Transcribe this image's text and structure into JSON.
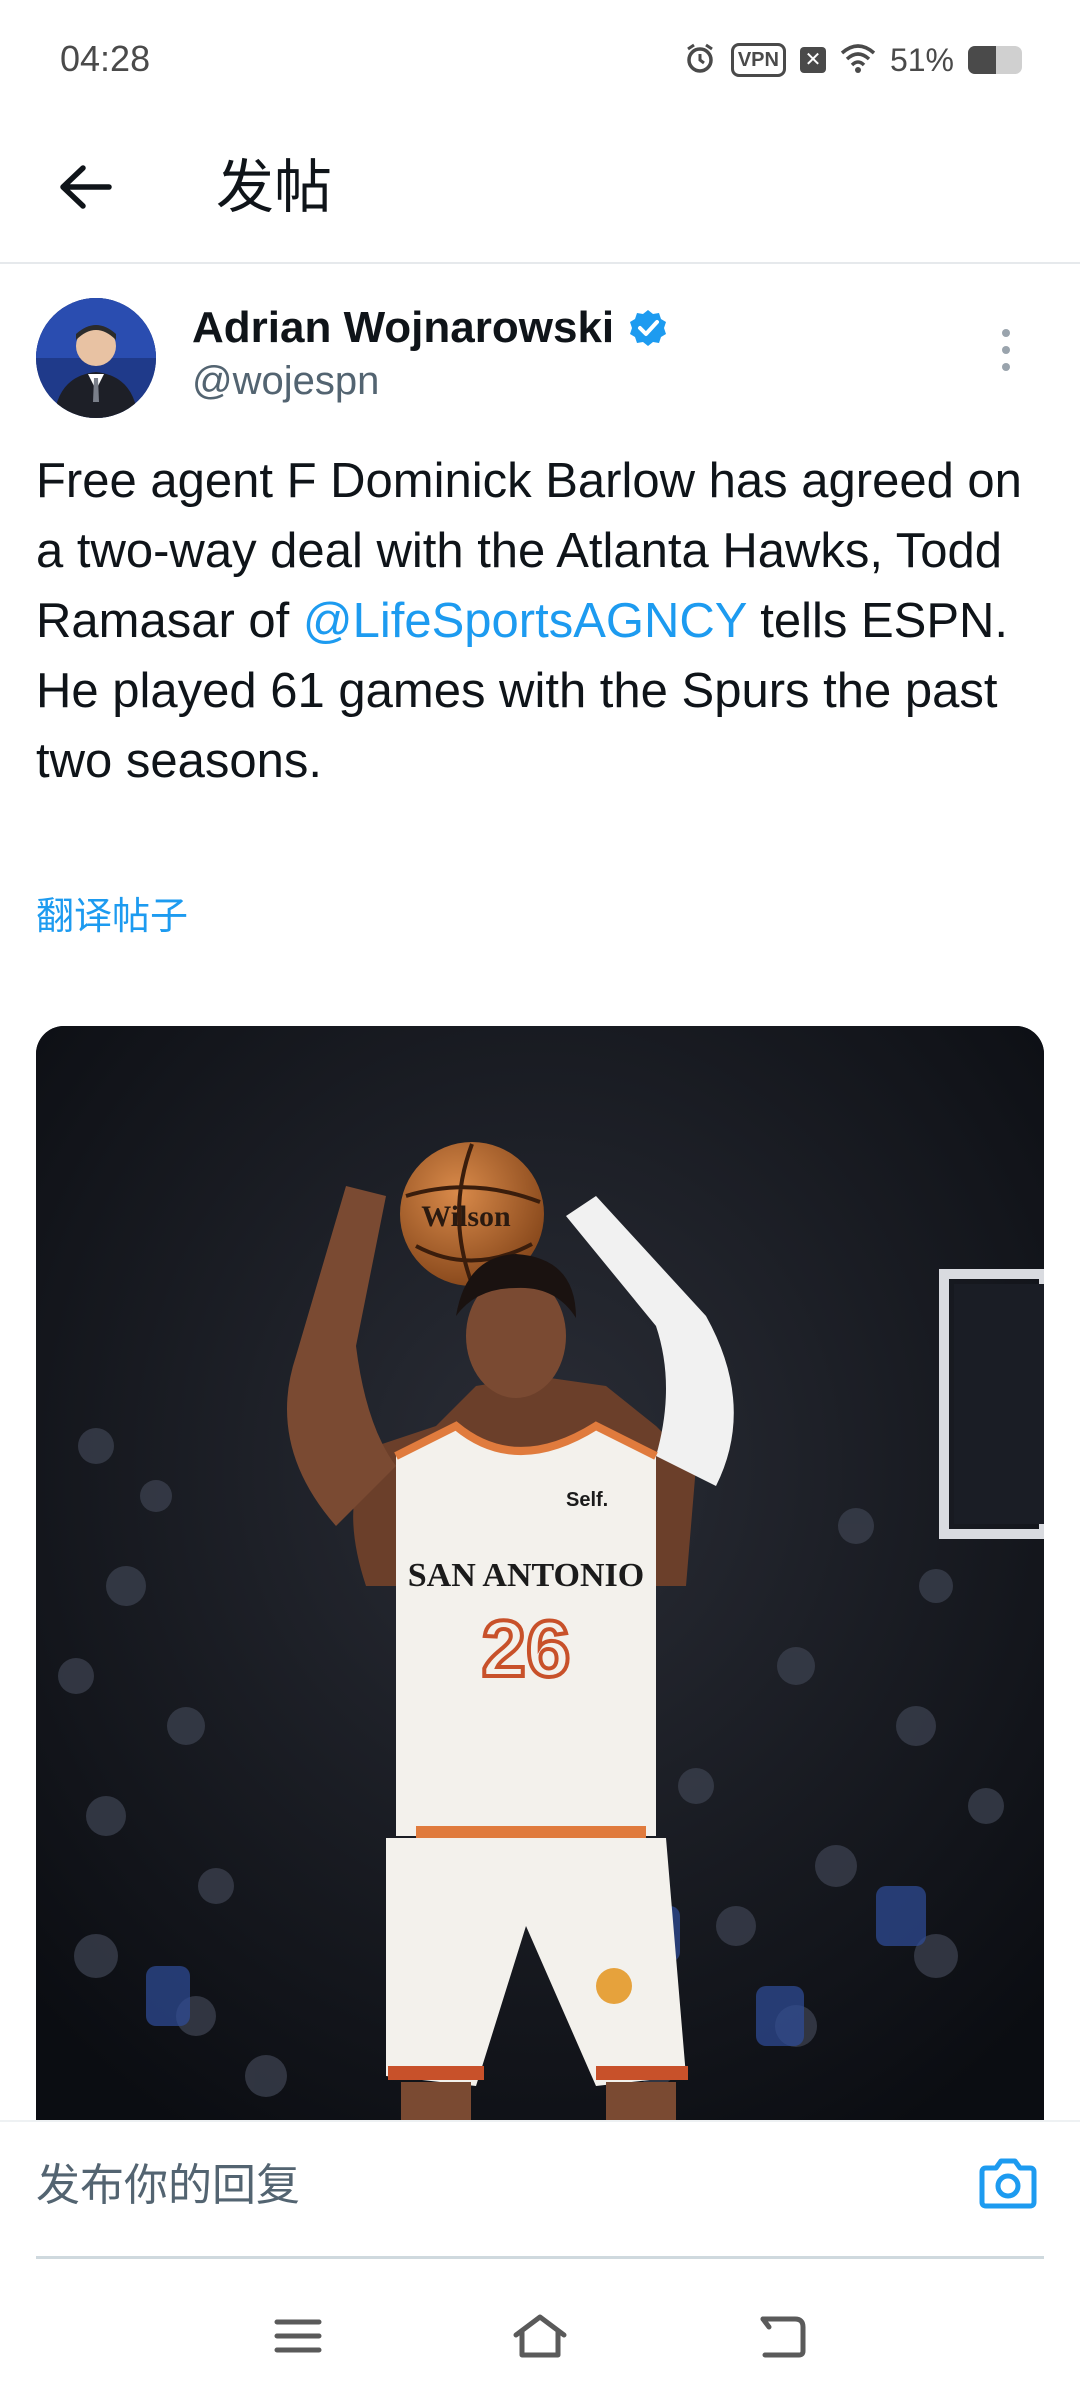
{
  "status_bar": {
    "time": "04:28",
    "vpn_label": "VPN",
    "battery_percent": "51%",
    "battery_level": 0.51,
    "icons": [
      "alarm-icon",
      "vpn-icon",
      "close-box-icon",
      "wifi-icon",
      "battery-icon"
    ]
  },
  "header": {
    "title": "发帖",
    "back_icon": "arrow-left-icon"
  },
  "tweet": {
    "author_name": "Adrian Wojnarowski",
    "handle": "@wojespn",
    "text_part1": "Free agent F Dominick Barlow has agreed on a two-way deal with the Atlanta Hawks, Todd Ramasar of ",
    "mention": "@LifeSportsAGNCY",
    "text_part2": " tells ESPN. He played 61 games with the Spurs the past two seasons.",
    "translate_label": "翻译帖子",
    "media": {
      "jersey_team": "SAN ANTONIO",
      "jersey_number": "26",
      "jersey_sponsor": "Self.",
      "ball_brand": "Wilson"
    }
  },
  "reply": {
    "placeholder": "发布你的回复"
  },
  "colors": {
    "accent": "#1d9bf0",
    "text": "#0f1419",
    "secondary_text": "#536471"
  }
}
